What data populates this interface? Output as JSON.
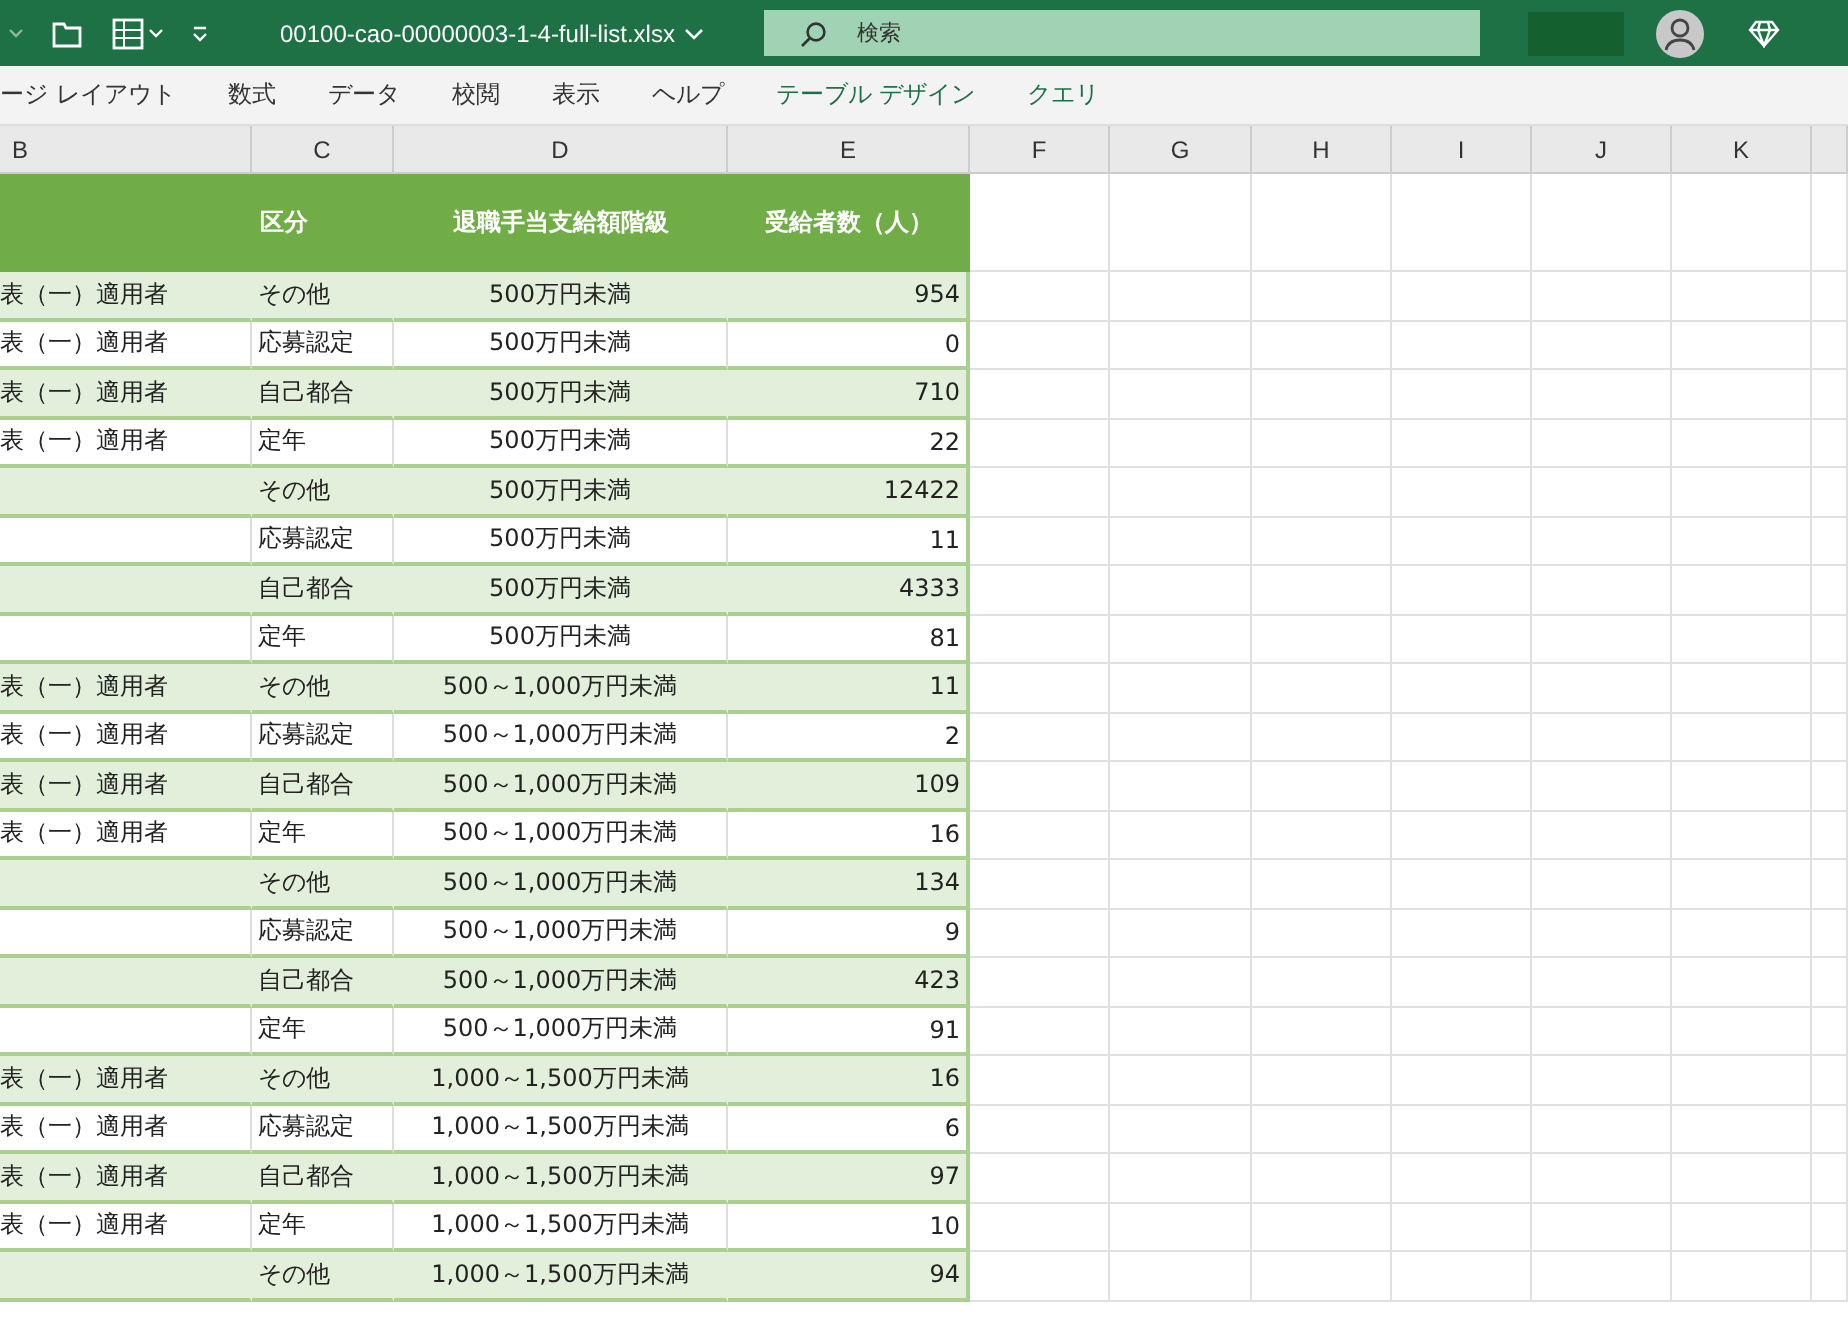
{
  "title_bar": {
    "filename": "00100-cao-00000003-1-4-full-list.xlsx",
    "search": {
      "placeholder": "検索"
    }
  },
  "ribbon_tabs": [
    {
      "label": "ージ レイアウト",
      "contextual": false
    },
    {
      "label": "数式",
      "contextual": false
    },
    {
      "label": "データ",
      "contextual": false
    },
    {
      "label": "校閲",
      "contextual": false
    },
    {
      "label": "表示",
      "contextual": false
    },
    {
      "label": "ヘルプ",
      "contextual": false
    },
    {
      "label": "テーブル デザイン",
      "contextual": true
    },
    {
      "label": "クエリ",
      "contextual": true
    }
  ],
  "column_headers": [
    "B",
    "C",
    "D",
    "E",
    "F",
    "G",
    "H",
    "I",
    "J",
    "K"
  ],
  "table": {
    "columns": [
      "区分",
      "退職手当支給額階級",
      "受給者数（人）"
    ],
    "rows": [
      {
        "column_b": "表（一）適用者",
        "category": "その他",
        "bracket": "500万円未満",
        "count": "954"
      },
      {
        "column_b": "表（一）適用者",
        "category": "応募認定",
        "bracket": "500万円未満",
        "count": "0"
      },
      {
        "column_b": "表（一）適用者",
        "category": "自己都合",
        "bracket": "500万円未満",
        "count": "710"
      },
      {
        "column_b": "表（一）適用者",
        "category": "定年",
        "bracket": "500万円未満",
        "count": "22"
      },
      {
        "category": "その他",
        "bracket": "500万円未満",
        "count": "12422"
      },
      {
        "category": "応募認定",
        "bracket": "500万円未満",
        "count": "11"
      },
      {
        "category": "自己都合",
        "bracket": "500万円未満",
        "count": "4333"
      },
      {
        "category": "定年",
        "bracket": "500万円未満",
        "count": "81"
      },
      {
        "column_b": "表（一）適用者",
        "category": "その他",
        "bracket": "500～1,000万円未満",
        "count": "11"
      },
      {
        "column_b": "表（一）適用者",
        "category": "応募認定",
        "bracket": "500～1,000万円未満",
        "count": "2"
      },
      {
        "column_b": "表（一）適用者",
        "category": "自己都合",
        "bracket": "500～1,000万円未満",
        "count": "109"
      },
      {
        "column_b": "表（一）適用者",
        "category": "定年",
        "bracket": "500～1,000万円未満",
        "count": "16"
      },
      {
        "category": "その他",
        "bracket": "500～1,000万円未満",
        "count": "134"
      },
      {
        "category": "応募認定",
        "bracket": "500～1,000万円未満",
        "count": "9"
      },
      {
        "category": "自己都合",
        "bracket": "500～1,000万円未満",
        "count": "423"
      },
      {
        "category": "定年",
        "bracket": "500～1,000万円未満",
        "count": "91"
      },
      {
        "column_b": "表（一）適用者",
        "category": "その他",
        "bracket": "1,000～1,500万円未満",
        "count": "16"
      },
      {
        "column_b": "表（一）適用者",
        "category": "応募認定",
        "bracket": "1,000～1,500万円未満",
        "count": "6"
      },
      {
        "column_b": "表（一）適用者",
        "category": "自己都合",
        "bracket": "1,000～1,500万円未満",
        "count": "97"
      },
      {
        "column_b": "表（一）適用者",
        "category": "定年",
        "bracket": "1,000～1,500万円未満",
        "count": "10"
      },
      {
        "category": "その他",
        "bracket": "1,000～1,500万円未満",
        "count": "94"
      }
    ]
  }
}
